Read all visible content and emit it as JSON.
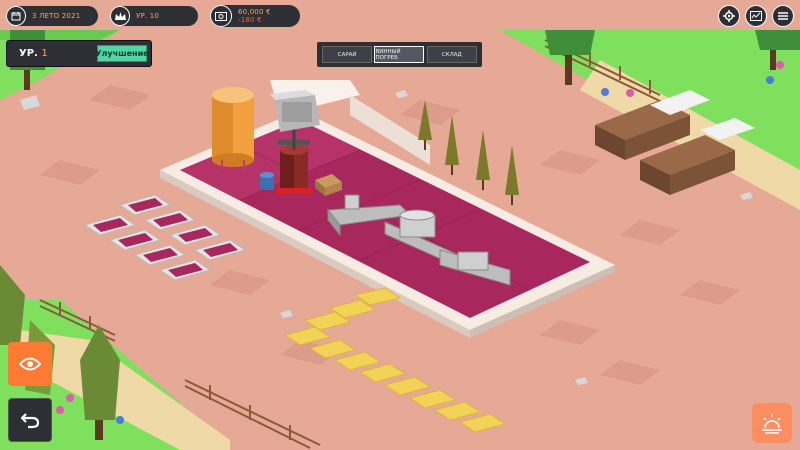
{
  "hud": {
    "date": "3 ЛЕТО 2021",
    "level": "УР. 10",
    "money": "60,000 €",
    "money_change": "-180 €"
  },
  "icons": {
    "calendar": "calendar-icon",
    "crown": "crown-icon",
    "money": "money-icon",
    "settings": "gear-icon",
    "stats": "stats-icon",
    "menu": "menu-icon",
    "eye": "eye-icon",
    "back": "back-arrow-icon",
    "weather": "sun-weather-icon"
  },
  "building_panel": {
    "level_prefix": "УР.",
    "level_value": "1",
    "upgrade_label": "Улучшение"
  },
  "tabs": [
    {
      "label": "САРАЙ",
      "active": false
    },
    {
      "label": "ВИННЫЙ ПОГРЕБ",
      "active": true
    },
    {
      "label": "СКЛАД",
      "active": false
    }
  ],
  "colors": {
    "ground": "#e6a996",
    "grass": "#7fe05e",
    "floor": "#a8285e",
    "path": "#f2d257",
    "accent": "#f5a561",
    "hud_dark": "#2e2f35",
    "upgrade_green": "#4ed6a3",
    "eye_orange": "#ff7a32"
  }
}
